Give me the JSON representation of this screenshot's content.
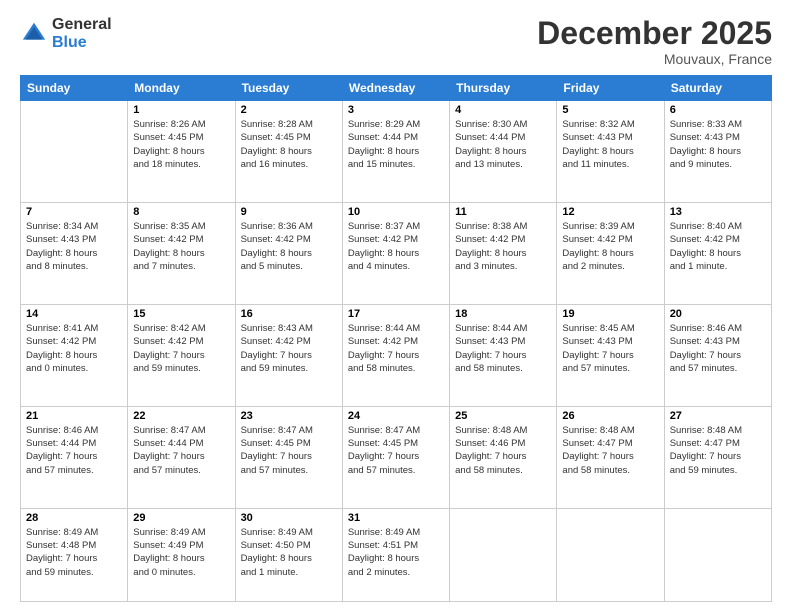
{
  "logo": {
    "general": "General",
    "blue": "Blue"
  },
  "title": "December 2025",
  "location": "Mouvaux, France",
  "weekdays": [
    "Sunday",
    "Monday",
    "Tuesday",
    "Wednesday",
    "Thursday",
    "Friday",
    "Saturday"
  ],
  "weeks": [
    [
      {
        "day": "",
        "info": ""
      },
      {
        "day": "1",
        "info": "Sunrise: 8:26 AM\nSunset: 4:45 PM\nDaylight: 8 hours\nand 18 minutes."
      },
      {
        "day": "2",
        "info": "Sunrise: 8:28 AM\nSunset: 4:45 PM\nDaylight: 8 hours\nand 16 minutes."
      },
      {
        "day": "3",
        "info": "Sunrise: 8:29 AM\nSunset: 4:44 PM\nDaylight: 8 hours\nand 15 minutes."
      },
      {
        "day": "4",
        "info": "Sunrise: 8:30 AM\nSunset: 4:44 PM\nDaylight: 8 hours\nand 13 minutes."
      },
      {
        "day": "5",
        "info": "Sunrise: 8:32 AM\nSunset: 4:43 PM\nDaylight: 8 hours\nand 11 minutes."
      },
      {
        "day": "6",
        "info": "Sunrise: 8:33 AM\nSunset: 4:43 PM\nDaylight: 8 hours\nand 9 minutes."
      }
    ],
    [
      {
        "day": "7",
        "info": "Sunrise: 8:34 AM\nSunset: 4:43 PM\nDaylight: 8 hours\nand 8 minutes."
      },
      {
        "day": "8",
        "info": "Sunrise: 8:35 AM\nSunset: 4:42 PM\nDaylight: 8 hours\nand 7 minutes."
      },
      {
        "day": "9",
        "info": "Sunrise: 8:36 AM\nSunset: 4:42 PM\nDaylight: 8 hours\nand 5 minutes."
      },
      {
        "day": "10",
        "info": "Sunrise: 8:37 AM\nSunset: 4:42 PM\nDaylight: 8 hours\nand 4 minutes."
      },
      {
        "day": "11",
        "info": "Sunrise: 8:38 AM\nSunset: 4:42 PM\nDaylight: 8 hours\nand 3 minutes."
      },
      {
        "day": "12",
        "info": "Sunrise: 8:39 AM\nSunset: 4:42 PM\nDaylight: 8 hours\nand 2 minutes."
      },
      {
        "day": "13",
        "info": "Sunrise: 8:40 AM\nSunset: 4:42 PM\nDaylight: 8 hours\nand 1 minute."
      }
    ],
    [
      {
        "day": "14",
        "info": "Sunrise: 8:41 AM\nSunset: 4:42 PM\nDaylight: 8 hours\nand 0 minutes."
      },
      {
        "day": "15",
        "info": "Sunrise: 8:42 AM\nSunset: 4:42 PM\nDaylight: 7 hours\nand 59 minutes."
      },
      {
        "day": "16",
        "info": "Sunrise: 8:43 AM\nSunset: 4:42 PM\nDaylight: 7 hours\nand 59 minutes."
      },
      {
        "day": "17",
        "info": "Sunrise: 8:44 AM\nSunset: 4:42 PM\nDaylight: 7 hours\nand 58 minutes."
      },
      {
        "day": "18",
        "info": "Sunrise: 8:44 AM\nSunset: 4:43 PM\nDaylight: 7 hours\nand 58 minutes."
      },
      {
        "day": "19",
        "info": "Sunrise: 8:45 AM\nSunset: 4:43 PM\nDaylight: 7 hours\nand 57 minutes."
      },
      {
        "day": "20",
        "info": "Sunrise: 8:46 AM\nSunset: 4:43 PM\nDaylight: 7 hours\nand 57 minutes."
      }
    ],
    [
      {
        "day": "21",
        "info": "Sunrise: 8:46 AM\nSunset: 4:44 PM\nDaylight: 7 hours\nand 57 minutes."
      },
      {
        "day": "22",
        "info": "Sunrise: 8:47 AM\nSunset: 4:44 PM\nDaylight: 7 hours\nand 57 minutes."
      },
      {
        "day": "23",
        "info": "Sunrise: 8:47 AM\nSunset: 4:45 PM\nDaylight: 7 hours\nand 57 minutes."
      },
      {
        "day": "24",
        "info": "Sunrise: 8:47 AM\nSunset: 4:45 PM\nDaylight: 7 hours\nand 57 minutes."
      },
      {
        "day": "25",
        "info": "Sunrise: 8:48 AM\nSunset: 4:46 PM\nDaylight: 7 hours\nand 58 minutes."
      },
      {
        "day": "26",
        "info": "Sunrise: 8:48 AM\nSunset: 4:47 PM\nDaylight: 7 hours\nand 58 minutes."
      },
      {
        "day": "27",
        "info": "Sunrise: 8:48 AM\nSunset: 4:47 PM\nDaylight: 7 hours\nand 59 minutes."
      }
    ],
    [
      {
        "day": "28",
        "info": "Sunrise: 8:49 AM\nSunset: 4:48 PM\nDaylight: 7 hours\nand 59 minutes."
      },
      {
        "day": "29",
        "info": "Sunrise: 8:49 AM\nSunset: 4:49 PM\nDaylight: 8 hours\nand 0 minutes."
      },
      {
        "day": "30",
        "info": "Sunrise: 8:49 AM\nSunset: 4:50 PM\nDaylight: 8 hours\nand 1 minute."
      },
      {
        "day": "31",
        "info": "Sunrise: 8:49 AM\nSunset: 4:51 PM\nDaylight: 8 hours\nand 2 minutes."
      },
      {
        "day": "",
        "info": ""
      },
      {
        "day": "",
        "info": ""
      },
      {
        "day": "",
        "info": ""
      }
    ]
  ]
}
